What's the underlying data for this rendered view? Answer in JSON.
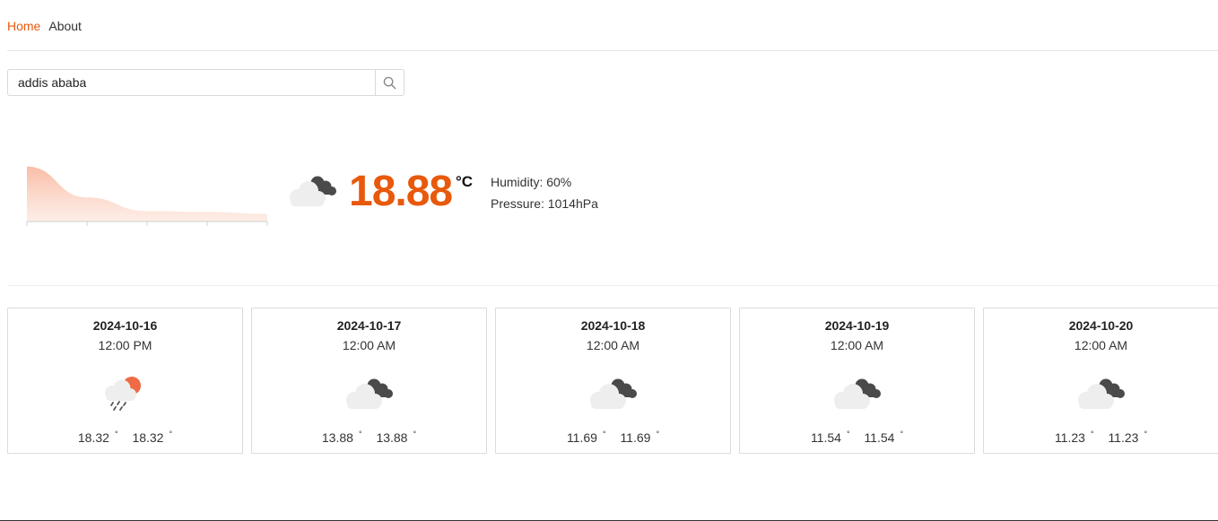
{
  "nav": {
    "home": "Home",
    "about": "About"
  },
  "search": {
    "value": "addis ababa",
    "icon": "search-icon"
  },
  "current": {
    "temperature": "18.88",
    "unit": "°C",
    "icon": "cloudy-icon",
    "humidity": "Humidity: 60%",
    "pressure": "Pressure: 1014hPa"
  },
  "chart_data": {
    "type": "area",
    "x": [
      0,
      1,
      2,
      3,
      4
    ],
    "values": [
      18.88,
      13.88,
      11.69,
      11.54,
      11.23
    ],
    "ylim": [
      10,
      20
    ],
    "grid": false,
    "color": "#f9c9b6"
  },
  "forecast": [
    {
      "date": "2024-10-16",
      "time": "12:00 PM",
      "icon": "rain-sun-icon",
      "min": "18.32",
      "max": "18.32"
    },
    {
      "date": "2024-10-17",
      "time": "12:00 AM",
      "icon": "cloudy-icon",
      "min": "13.88",
      "max": "13.88"
    },
    {
      "date": "2024-10-18",
      "time": "12:00 AM",
      "icon": "cloudy-icon",
      "min": "11.69",
      "max": "11.69"
    },
    {
      "date": "2024-10-19",
      "time": "12:00 AM",
      "icon": "cloudy-icon",
      "min": "11.54",
      "max": "11.54"
    },
    {
      "date": "2024-10-20",
      "time": "12:00 AM",
      "icon": "cloudy-icon",
      "min": "11.23",
      "max": "11.23"
    }
  ],
  "colors": {
    "accent": "#e8590c",
    "sun": "#ef6a45"
  }
}
